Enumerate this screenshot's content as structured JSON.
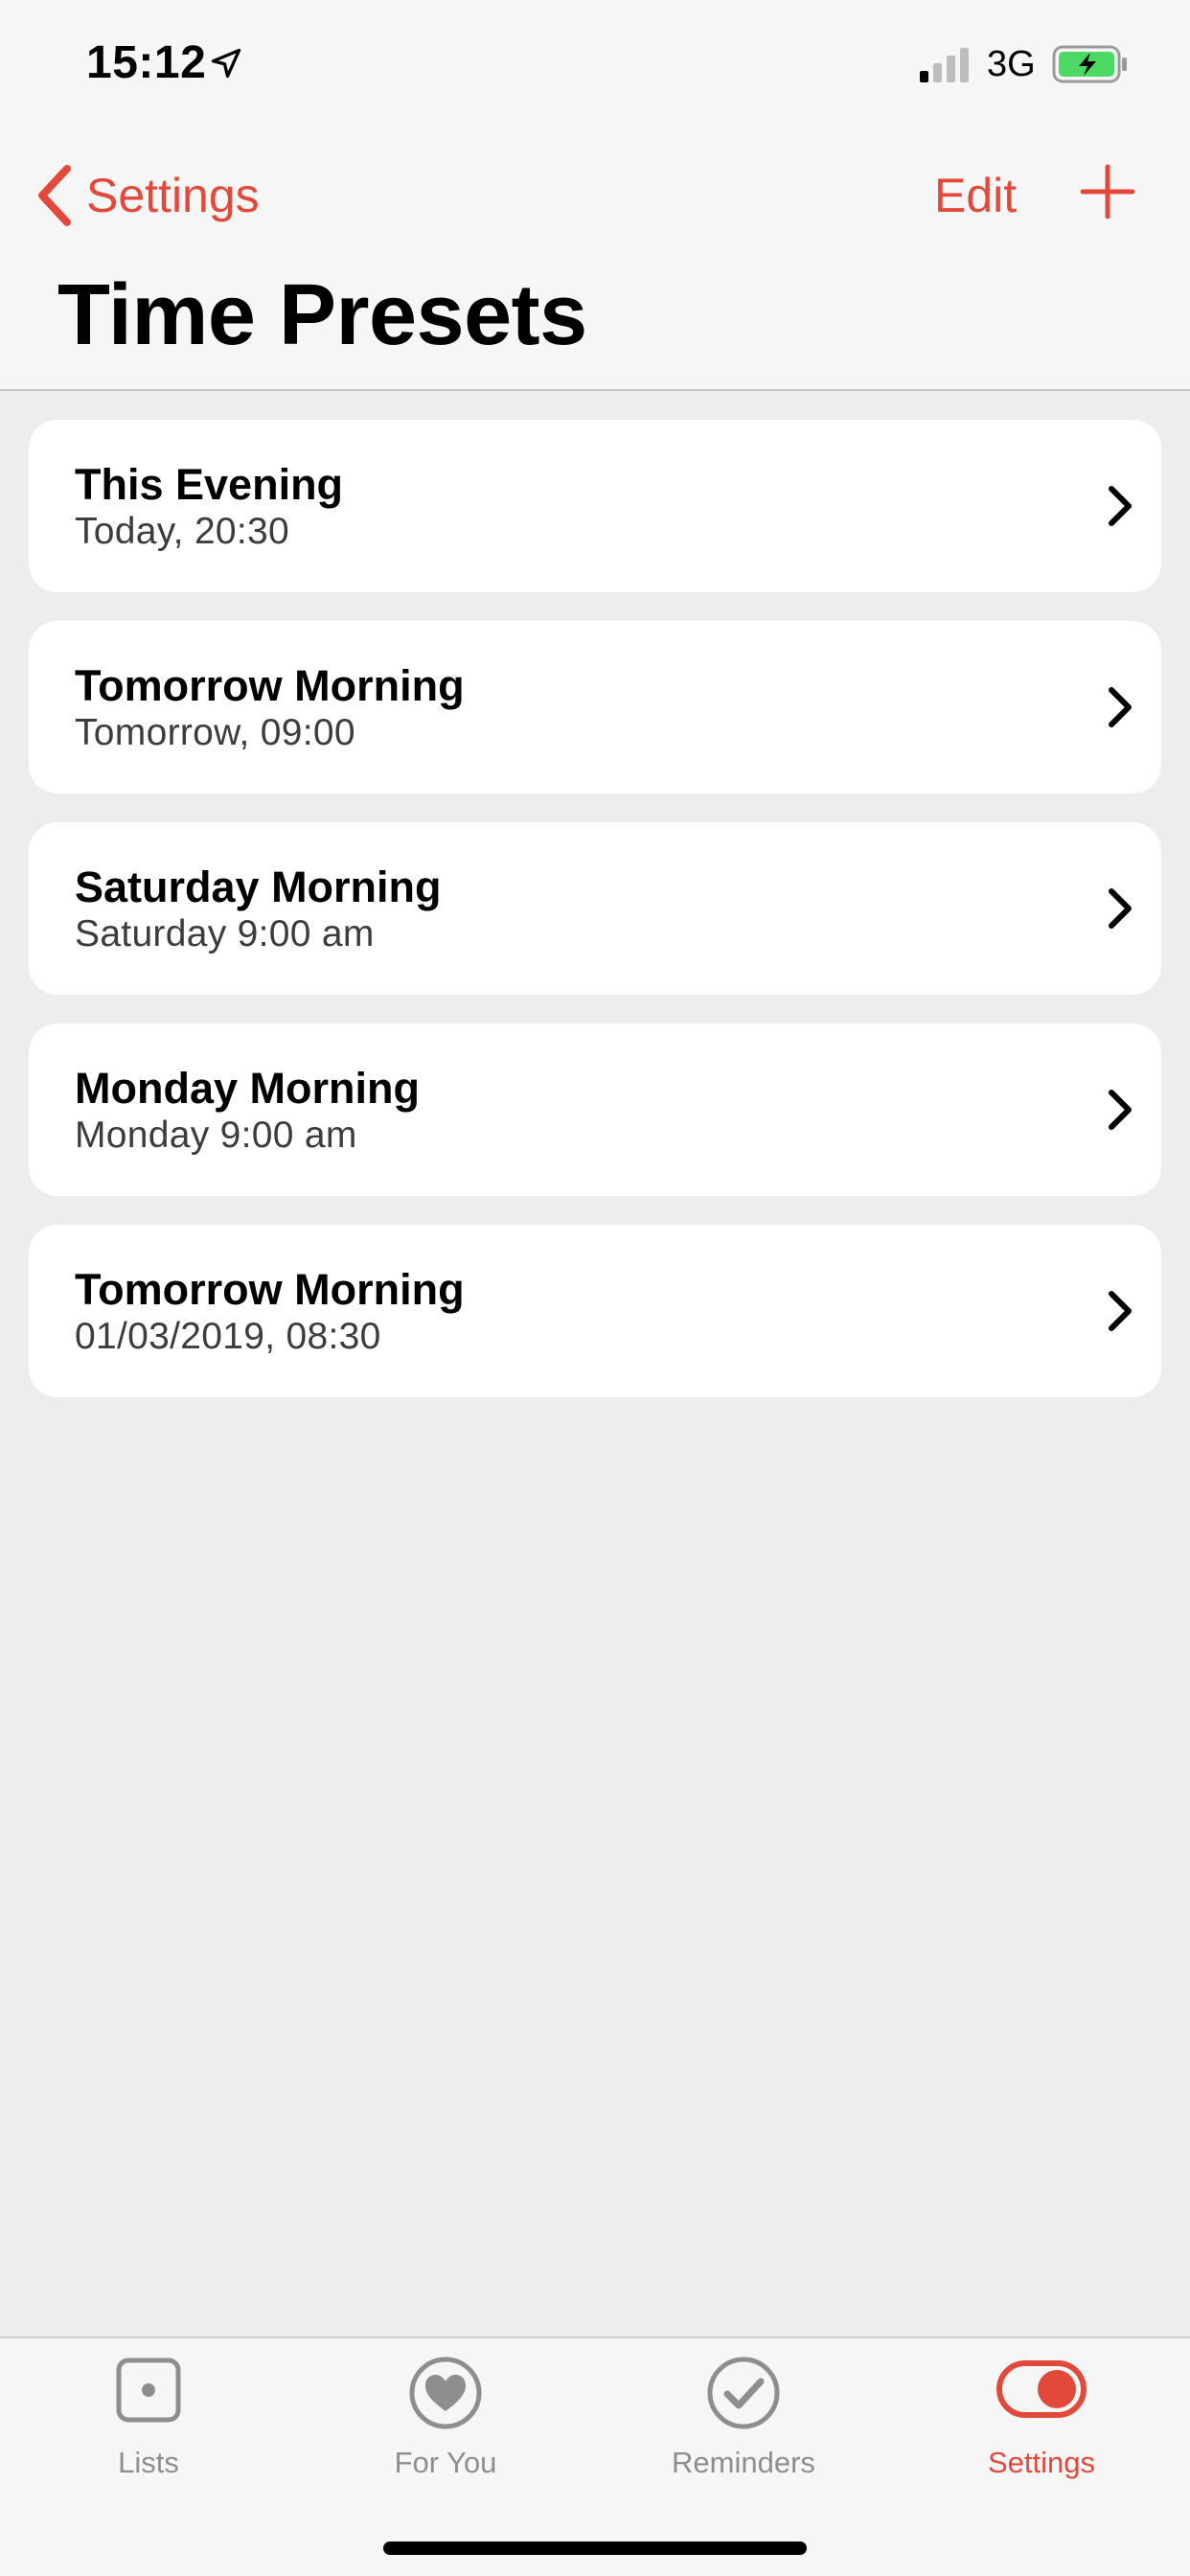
{
  "status_bar": {
    "time": "15:12",
    "network": "3G",
    "location_icon": "location-arrow-icon",
    "signal_icon": "signal-bars-icon",
    "battery_icon": "battery-charging-icon",
    "battery_color": "#4cd964"
  },
  "nav": {
    "back_label": "Settings",
    "edit_label": "Edit",
    "add_icon": "plus-icon",
    "title": "Time Presets"
  },
  "presets": [
    {
      "title": "This Evening",
      "subtitle": "Today, 20:30"
    },
    {
      "title": "Tomorrow Morning",
      "subtitle": "Tomorrow, 09:00"
    },
    {
      "title": "Saturday Morning",
      "subtitle": "Saturday 9:00 am"
    },
    {
      "title": "Monday Morning",
      "subtitle": "Monday 9:00 am"
    },
    {
      "title": "Tomorrow Morning",
      "subtitle": "01/03/2019, 08:30"
    }
  ],
  "tabs": [
    {
      "label": "Lists",
      "icon": "list-square-icon",
      "active": false
    },
    {
      "label": "For You",
      "icon": "heart-icon",
      "active": false
    },
    {
      "label": "Reminders",
      "icon": "checkmark-circle-icon",
      "active": false
    },
    {
      "label": "Settings",
      "icon": "toggle-icon",
      "active": true
    }
  ],
  "colors": {
    "accent": "#e2493b",
    "inactive": "#8e8e8e",
    "background": "#ededed"
  }
}
